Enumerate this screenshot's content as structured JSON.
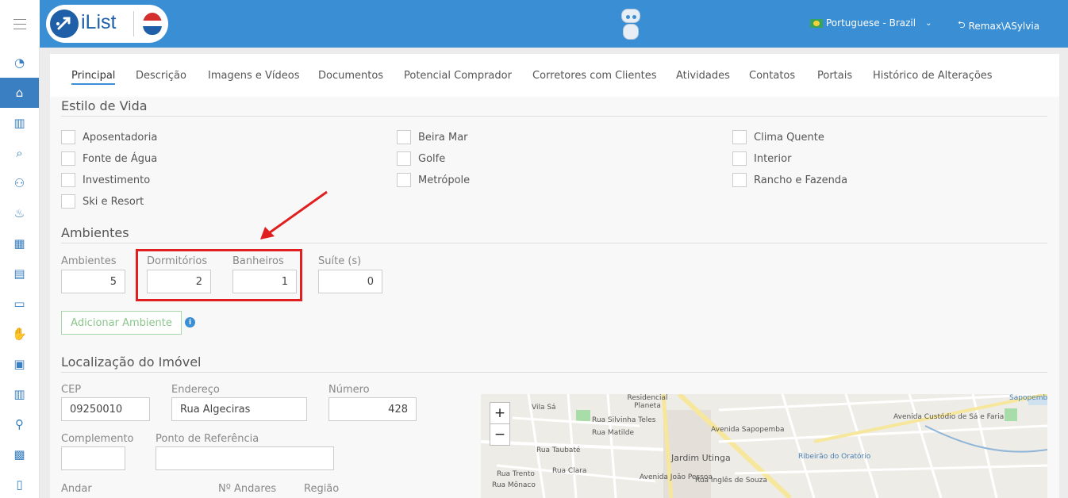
{
  "header": {
    "logo_text": "iList",
    "language": "Portuguese - Brazil",
    "user": "Remax\\ASylvia"
  },
  "tabs": [
    "Principal",
    "Descrição",
    "Imagens e Vídeos",
    "Documentos",
    "Potencial Comprador",
    "Corretores com Clientes",
    "Atividades",
    "Contatos",
    "Portais",
    "Histórico de Alterações"
  ],
  "lifestyle": {
    "title": "Estilo de Vida",
    "options": [
      "Aposentadoria",
      "Beira Mar",
      "Clima Quente",
      "Fonte de Água",
      "Golfe",
      "Interior",
      "Investimento",
      "Metrópole",
      "Rancho e Fazenda",
      "Ski e Resort"
    ]
  },
  "rooms": {
    "title": "Ambientes",
    "ambientes_label": "Ambientes",
    "ambientes_value": "5",
    "dormitorios_label": "Dormitórios",
    "dormitorios_value": "2",
    "banheiros_label": "Banheiros",
    "banheiros_value": "1",
    "suite_label": "Suíte (s)",
    "suite_value": "0",
    "add_button": "Adicionar Ambiente"
  },
  "location": {
    "title": "Localização do Imóvel",
    "cep_label": "CEP",
    "cep_value": "09250010",
    "endereco_label": "Endereço",
    "endereco_value": "Rua Algeciras",
    "numero_label": "Número",
    "numero_value": "428",
    "complemento_label": "Complemento",
    "complemento_value": "",
    "referencia_label": "Ponto de Referência",
    "referencia_value": "",
    "andar_label": "Andar",
    "n_andares_label": "Nº Andares",
    "regiao_label": "Região"
  },
  "map": {
    "zoom_in": "+",
    "zoom_out": "−",
    "labels": [
      "Vila Sá",
      "Residencial Planeta",
      "Rua Silvinha Teles",
      "Rua Matilde",
      "Rua Taubaté",
      "Jardim Utinga",
      "Avenida João Pessoa",
      "Avenida Sapopemba",
      "Rua Clara",
      "Rua Trento",
      "Rua Mônaco",
      "Rua Inglês de Souza",
      "Ribeirão do Oratório",
      "Avenida Custódio de Sá e Faria",
      "Sapopemba"
    ]
  },
  "colors": {
    "topbar": "#3a8ed4",
    "sidebar_active": "#3a7fc1",
    "highlight": "#e02020",
    "add_button_text": "#8bc58b"
  },
  "sidebar_icons": [
    "dashboard-icon",
    "home-icon",
    "bar-chart-icon",
    "search-icon",
    "users-icon",
    "fire-icon",
    "calendar-icon",
    "book-icon",
    "folder-icon",
    "handshake-icon",
    "briefcase-icon",
    "report-icon",
    "user-icon",
    "store-icon",
    "mobile-icon"
  ]
}
